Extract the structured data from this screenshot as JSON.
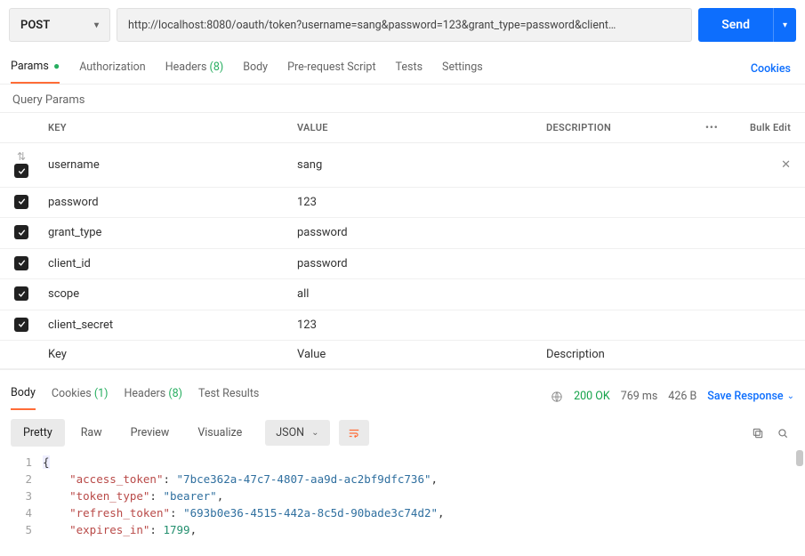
{
  "request": {
    "method": "POST",
    "url": "http://localhost:8080/oauth/token?username=sang&password=123&grant_type=password&client…",
    "sendLabel": "Send"
  },
  "reqTabs": {
    "params": "Params",
    "auth": "Authorization",
    "headers": "Headers",
    "headersCount": "(8)",
    "body": "Body",
    "prereq": "Pre-request Script",
    "tests": "Tests",
    "settings": "Settings",
    "cookies": "Cookies"
  },
  "queryParamsLabel": "Query Params",
  "columns": {
    "key": "KEY",
    "value": "VALUE",
    "desc": "DESCRIPTION",
    "bulk": "Bulk Edit"
  },
  "placeholders": {
    "key": "Key",
    "value": "Value",
    "desc": "Description"
  },
  "params": [
    {
      "enabled": true,
      "key": "username",
      "value": "sang"
    },
    {
      "enabled": true,
      "key": "password",
      "value": "123"
    },
    {
      "enabled": true,
      "key": "grant_type",
      "value": "password"
    },
    {
      "enabled": true,
      "key": "client_id",
      "value": "password"
    },
    {
      "enabled": true,
      "key": "scope",
      "value": "all"
    },
    {
      "enabled": true,
      "key": "client_secret",
      "value": "123"
    }
  ],
  "respTabs": {
    "body": "Body",
    "cookies": "Cookies",
    "cookiesCount": "(1)",
    "headers": "Headers",
    "headersCount": "(8)",
    "tests": "Test Results"
  },
  "status": {
    "code": "200 OK",
    "time": "769 ms",
    "size": "426 B",
    "save": "Save Response"
  },
  "bodyToolbar": {
    "pretty": "Pretty",
    "raw": "Raw",
    "preview": "Preview",
    "visualize": "Visualize",
    "format": "JSON"
  },
  "responseJson": {
    "access_token": "7bce362a-47c7-4807-aa9d-ac2bf9dfc736",
    "token_type": "bearer",
    "refresh_token": "693b0e36-4515-442a-8c5d-90bade3c74d2",
    "expires_in": 1799
  }
}
